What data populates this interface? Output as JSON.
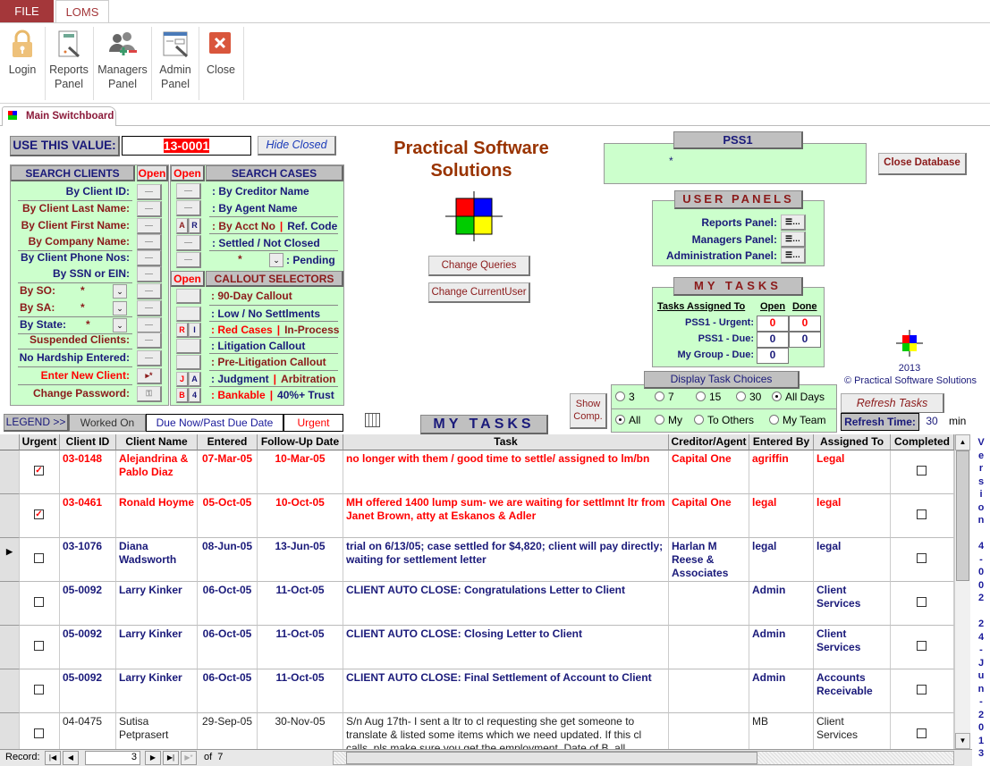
{
  "ribbon": {
    "tabs": [
      "FILE",
      "LOMS"
    ],
    "buttons": [
      {
        "label": "Login",
        "icon": "lock-icon"
      },
      {
        "label": "Reports Panel",
        "icon": "reports-icon"
      },
      {
        "label": "Managers Panel",
        "icon": "managers-icon"
      },
      {
        "label": "Admin Panel",
        "icon": "admin-icon"
      },
      {
        "label": "Close",
        "icon": "close-icon"
      }
    ]
  },
  "doc_tab": "Main Switchboard",
  "use_value": {
    "label": "USE THIS VALUE:",
    "value": "13-0001",
    "hide_closed": "Hide Closed"
  },
  "title": "Practical Software Solutions",
  "change_queries": "Change Queries",
  "change_user": "Change CurrentUser",
  "pss1": {
    "header": "PSS1",
    "value": "*",
    "close_db": "Close Database"
  },
  "search_clients": {
    "header": "SEARCH CLIENTS",
    "open": "Open",
    "items": [
      {
        "label": "By Client ID:",
        "color": "navy"
      },
      {
        "label": "By Client Last Name:",
        "color": "mar"
      },
      {
        "label": "By Client First Name:",
        "color": "mar"
      },
      {
        "label": "By Company Name:",
        "color": "mar"
      },
      {
        "label": "By Client Phone Nos:",
        "color": "navy"
      },
      {
        "label": "By SSN or EIN:",
        "color": "navy"
      },
      {
        "label": "By SO:",
        "color": "mar",
        "value": "*"
      },
      {
        "label": "By SA:",
        "color": "mar",
        "value": "*"
      },
      {
        "label": "By State:",
        "color": "navy",
        "value": "*"
      },
      {
        "label": "Suspended Clients:",
        "color": "mar"
      },
      {
        "label": "No Hardship Entered:",
        "color": "navy"
      },
      {
        "label": "Enter New Client:",
        "color": "red"
      },
      {
        "label": "Change Password:",
        "color": "mar"
      }
    ]
  },
  "search_cases": {
    "header": "SEARCH CASES",
    "open": "Open",
    "items": [
      {
        "a": ": By Creditor Name"
      },
      {
        "a": ": By Agent Name"
      },
      {
        "a": ": By Acct No",
        "sep": "|",
        "b": "Ref. Code",
        "btns": [
          "A",
          "R"
        ]
      },
      {
        "a": ": Settled / Not Closed"
      },
      {
        "a": ": Pending",
        "value": "*"
      }
    ]
  },
  "callout": {
    "header": "CALLOUT SELECTORS",
    "open": "Open",
    "items": [
      {
        "a": ": 90-Day Callout",
        "ca": "mar"
      },
      {
        "a": ": Low / No Settlments",
        "ca": "navy"
      },
      {
        "a": ": Red Cases",
        "ca": "red",
        "sep": "|",
        "b": "In-Process",
        "cb": "mar",
        "btns": [
          "R",
          "I"
        ]
      },
      {
        "a": ": Litigation Callout",
        "ca": "navy"
      },
      {
        "a": ": Pre-Litigation Callout",
        "ca": "mar"
      },
      {
        "a": ": Judgment",
        "ca": "navy",
        "sep": "|",
        "b": "Arbitration",
        "cb": "mar",
        "btns": [
          "J",
          "A"
        ]
      },
      {
        "a": ": Bankable",
        "ca": "red",
        "sep": "|",
        "b": "40%+ Trust",
        "cb": "navy",
        "btns": [
          "B",
          "4"
        ]
      }
    ]
  },
  "legend": {
    "label": "LEGEND >>",
    "worked": "Worked On",
    "due": "Due Now/Past Due Date",
    "urgent": "Urgent"
  },
  "user_panels": {
    "header": "USER PANELS",
    "items": [
      "Reports Panel:",
      "Managers Panel:",
      "Administration Panel:"
    ]
  },
  "my_tasks_panel": {
    "header": "MY TASKS",
    "col_assigned": "Tasks Assigned To",
    "col_open": "Open",
    "col_done": "Done",
    "rows": [
      {
        "label": "PSS1 - Urgent:",
        "open": "0",
        "done": "0"
      },
      {
        "label": "PSS1 - Due:",
        "open": "0",
        "done": "0"
      },
      {
        "label": "My Group - Due:",
        "open": "0"
      }
    ]
  },
  "logo": {
    "year": "2013",
    "copyright": "© Practical Software Solutions"
  },
  "display_choices": {
    "header": "Display Task Choices",
    "days": [
      {
        "label": "3",
        "on": false
      },
      {
        "label": "7",
        "on": false
      },
      {
        "label": "15",
        "on": false
      },
      {
        "label": "30",
        "on": false
      },
      {
        "label": "All Days",
        "on": true
      }
    ],
    "who": [
      {
        "label": "All",
        "on": true
      },
      {
        "label": "My",
        "on": false
      },
      {
        "label": "To Others",
        "on": false
      },
      {
        "label": "My Team",
        "on": false
      }
    ]
  },
  "show_comp": "Show Comp.",
  "refresh": {
    "button": "Refresh Tasks",
    "label": "Refresh Time:",
    "value": "30",
    "unit": "min"
  },
  "my_tasks_title": "MY TASKS",
  "grid": {
    "columns": [
      "Urgent",
      "Client ID",
      "Client Name",
      "Entered",
      "Follow-Up Date",
      "Task",
      "Creditor/Agent",
      "Entered By",
      "Assigned To",
      "Completed"
    ],
    "rows": [
      {
        "urgent": true,
        "id": "03-0148",
        "name": "Alejandrina & Pablo Diaz",
        "entered": "07-Mar-05",
        "follow": "10-Mar-05",
        "task": "no longer with them / good time to settle/ assigned to lm/bn",
        "creditor": "Capital One",
        "by": "agriffin",
        "assigned": "Legal",
        "completed": false,
        "style": "urgent"
      },
      {
        "urgent": true,
        "id": "03-0461",
        "name": "Ronald Hoyme",
        "entered": "05-Oct-05",
        "follow": "10-Oct-05",
        "task": "MH offered 1400 lump sum- we are waiting for settlmnt ltr from Janet Brown, atty at Eskanos & Adler",
        "creditor": "Capital One",
        "by": "legal",
        "assigned": "legal",
        "completed": false,
        "style": "urgent"
      },
      {
        "urgent": false,
        "id": "03-1076",
        "name": "Diana Wadsworth",
        "entered": "08-Jun-05",
        "follow": "13-Jun-05",
        "task": "trial on 6/13/05; case settled for $4,820; client will pay directly; waiting for settlement letter",
        "creditor": "Harlan M Reese & Associates",
        "by": "legal",
        "assigned": "legal",
        "completed": false,
        "style": "due",
        "current": true
      },
      {
        "urgent": false,
        "id": "05-0092",
        "name": "Larry Kinker",
        "entered": "06-Oct-05",
        "follow": "11-Oct-05",
        "task": "CLIENT AUTO CLOSE: Congratulations Letter to Client",
        "creditor": "",
        "by": "Admin",
        "assigned": "Client Services",
        "completed": false,
        "style": "due"
      },
      {
        "urgent": false,
        "id": "05-0092",
        "name": "Larry Kinker",
        "entered": "06-Oct-05",
        "follow": "11-Oct-05",
        "task": "CLIENT AUTO CLOSE: Closing Letter to Client",
        "creditor": "",
        "by": "Admin",
        "assigned": "Client Services",
        "completed": false,
        "style": "due"
      },
      {
        "urgent": false,
        "id": "05-0092",
        "name": "Larry Kinker",
        "entered": "06-Oct-05",
        "follow": "11-Oct-05",
        "task": "CLIENT AUTO CLOSE: Final Settlement of Account to Client",
        "creditor": "",
        "by": "Admin",
        "assigned": "Accounts Receivable",
        "completed": false,
        "style": "due"
      },
      {
        "urgent": false,
        "id": "04-0475",
        "name": "Sutisa Petprasert",
        "entered": "29-Sep-05",
        "follow": "30-Nov-05",
        "task": "S/n Aug 17th- I sent a ltr to cl requesting she get someone to translate & listed some items which we need updated. If this cl calls, pls make sure you get the employment. Date of B, all",
        "creditor": "",
        "by": "MB",
        "assigned": "Client Services",
        "completed": false,
        "style": "normal"
      }
    ]
  },
  "record_nav": {
    "label": "Record:",
    "current": "3",
    "of": "of  7"
  },
  "version": "Version 4-002 24-Jun-2013",
  "colors": {
    "green_panel": "#ccffcc",
    "urgent": "#ff0000",
    "due": "#1a1a7a",
    "file_tab": "#a4373a"
  }
}
